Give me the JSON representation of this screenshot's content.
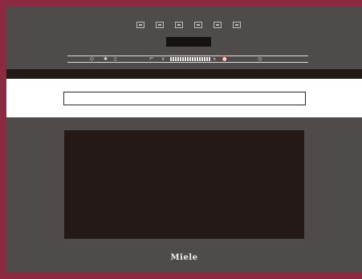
{
  "appliance": {
    "brand": "Miele",
    "program_icons": [
      "fan-oven-icon",
      "auto-roast-icon",
      "grill-icon",
      "conventional-heat-icon",
      "defrost-icon",
      "microwave-icon"
    ],
    "control_symbols": {
      "power": "⏻",
      "light": "✱",
      "back": "↶",
      "down": "∨",
      "up": "∧",
      "minute_minder": "⏰",
      "clock": "◷"
    },
    "display_value": ""
  },
  "colors": {
    "frame": "#8b2a40",
    "body": "#4e4b4a",
    "glass": "#231a18",
    "text": "#f2f2f2"
  }
}
